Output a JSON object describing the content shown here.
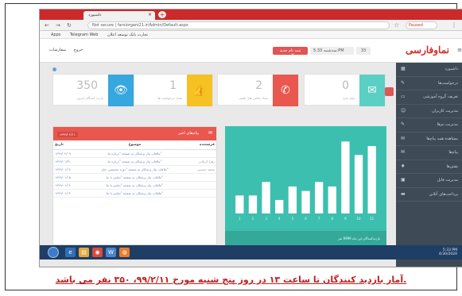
{
  "browser": {
    "tab_title": "داشبورد",
    "url": "Not secure | farsiorgani21.ir/Admin/Default.aspx",
    "profile_label": "Paused",
    "bookmarks": [
      "Apps",
      "Telegram Web",
      "تجارت بانک توسعه اعلان"
    ]
  },
  "header": {
    "logo": "نماوفارسی",
    "pill_red": "ثبت نام جدید کاربر",
    "pill_grey": "سه‌شنبه 5:33:PM",
    "pill_msg": "33",
    "left_items": [
      "سفارشات",
      "خروج"
    ]
  },
  "sidebar": {
    "items": [
      {
        "label": "داشبورد",
        "icon": "dashboard-icon"
      },
      {
        "label": "درخواست‌ها",
        "icon": "request-icon"
      },
      {
        "label": "تعریف گروه آموزشی",
        "icon": "folder-icon"
      },
      {
        "label": "مدیریت کاربران",
        "icon": "users-icon"
      },
      {
        "label": "مدیریت تم‌ها",
        "icon": "edit-icon"
      },
      {
        "label": "مشاهده همه پیام‌ها",
        "icon": "mail-icon"
      },
      {
        "label": "پیام‌ها",
        "icon": "message-icon"
      },
      {
        "label": "نقش‌ها",
        "icon": "role-icon"
      },
      {
        "label": "مدیریت فایل",
        "icon": "file-icon"
      },
      {
        "label": "پرداخت‌های آنلاین",
        "icon": "card-icon"
      }
    ]
  },
  "cards": [
    {
      "num": "0",
      "label": "پیام جدید",
      "icon": "envelope-icon",
      "color": "#5bcfc3"
    },
    {
      "num": "2",
      "label": "تعداد تماس های تلفنی",
      "icon": "phone-icon",
      "color": "#e9574e"
    },
    {
      "num": "1",
      "label": "تعداد درخواست ها",
      "icon": "thumbs-up-icon",
      "color": "#f5c123"
    },
    {
      "num": "350",
      "label": "بازدید کنندگان امروز",
      "icon": "eye-icon",
      "color": "#37a7df"
    }
  ],
  "messages": {
    "title": "پیام‌های اخیر",
    "date_badge": "۱۳۹۹/۰۲/۱۱",
    "columns": {
      "from": "فرستنده",
      "subject": "موضوع",
      "date": "تاریخ"
    },
    "rows": [
      {
        "from": "",
        "subject": "ملاقات نیاز پزشکان به صفحه \"درباره ما\"",
        "date": "۱۳۹۹/۰۲/۰۹"
      },
      {
        "from": "زهرا کربلایی",
        "subject": "ملاقات نیاز پزشکان به صفحه \"درباره ما\"",
        "date": "۱۳۹۹/۰۱/۳۱"
      },
      {
        "from": "محمد حسینی",
        "subject": "ملاقات نیاز پزشکان به صفحه \"دوره تخصصی چای\"",
        "date": "۱۳۹۹/۰۱/۱۷"
      },
      {
        "from": "",
        "subject": "ملاقات نیاز پزشکان به صفحه \"تماس با ما\"",
        "date": "۱۳۹۹/۰۱/۱۵"
      },
      {
        "from": "",
        "subject": "ملاقات نیاز پزشکان به صفحه \"تماس با ما\"",
        "date": "۱۳۹۹/۰۱/۱۴"
      },
      {
        "from": "",
        "subject": "ملاقات نیاز پزشکان به صفحه \"تماس با ما\"",
        "date": "۱۳۹۹/۰۱/۱۳"
      }
    ]
  },
  "chart_data": {
    "type": "bar",
    "title": "",
    "caption": "بازدیدکنندگان این ماه 9999 نفر",
    "categories": [
      "1",
      "2",
      "3",
      "4",
      "5",
      "6",
      "7",
      "8",
      "9",
      "10",
      "11"
    ],
    "values": [
      4,
      4,
      7,
      3,
      6,
      5,
      7,
      6,
      16,
      13,
      15
    ],
    "ylim": [
      0,
      18
    ],
    "grid": false
  },
  "taskbar": {
    "time": "5:33 PM",
    "date": "4/30/2020",
    "lang": "FA"
  },
  "caption": "آمار بازدید کنندگان تا ساعت ۱۳ در روز پنج شنبه مورخ ۹۹/۲/۱۱، ۳۵۰ نفر می باشد."
}
